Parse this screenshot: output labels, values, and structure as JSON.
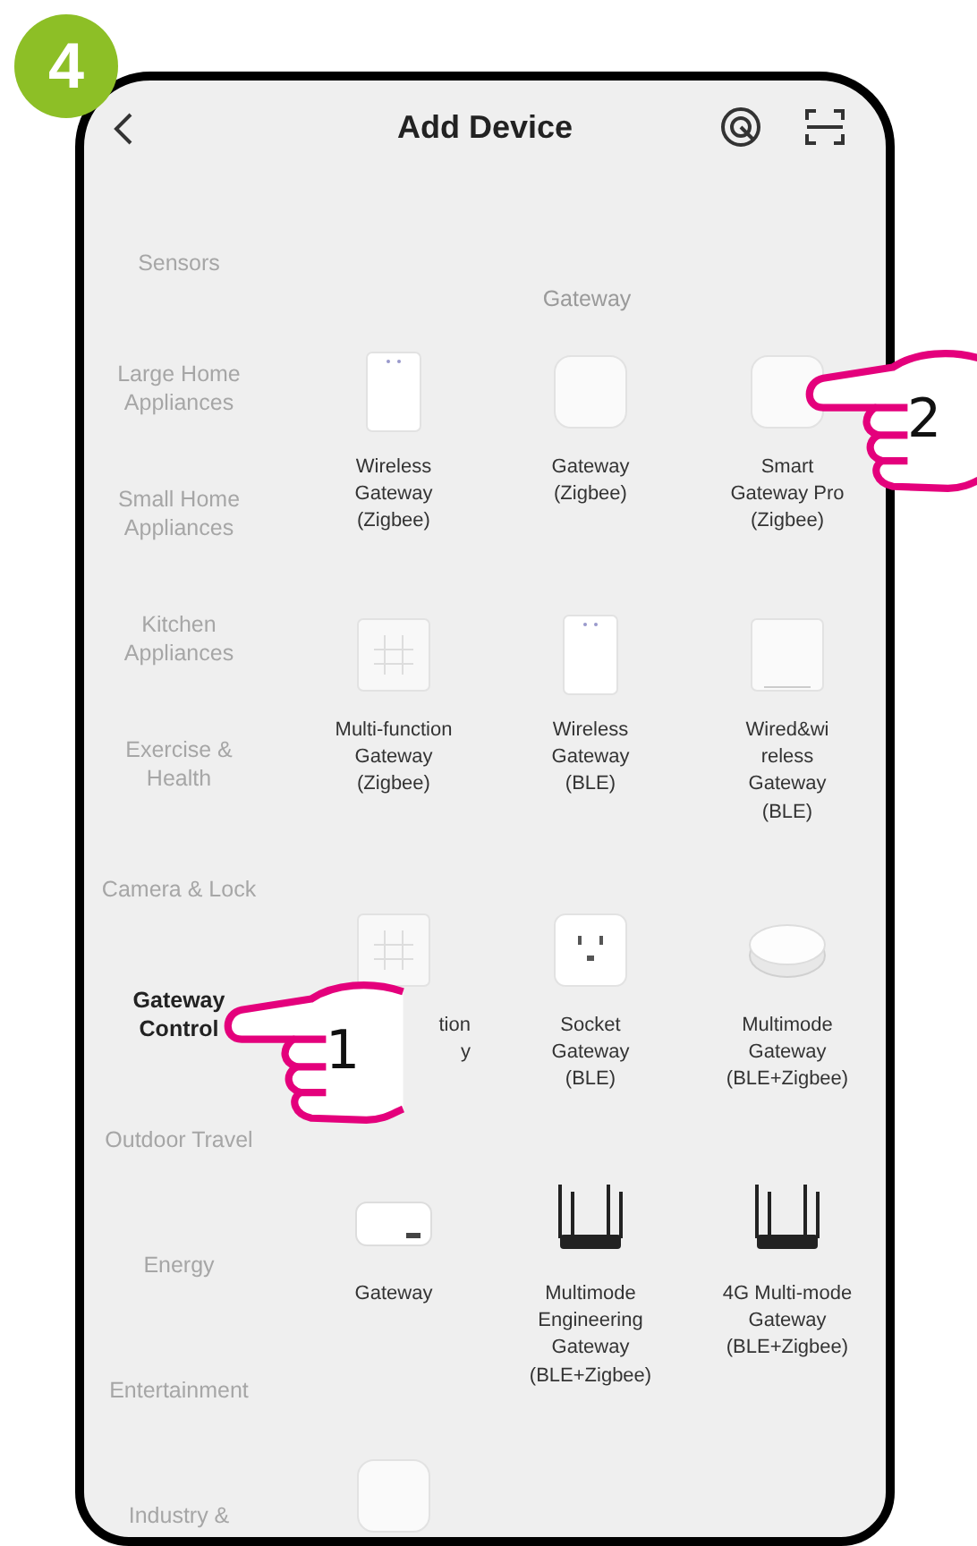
{
  "step_badge": "4",
  "header": {
    "title": "Add Device"
  },
  "sidebar": {
    "items": [
      {
        "label": "Sensors",
        "selected": false
      },
      {
        "label": "Large Home Appliances",
        "selected": false
      },
      {
        "label": "Small Home Appliances",
        "selected": false
      },
      {
        "label": "Kitchen Appliances",
        "selected": false
      },
      {
        "label": "Exercise & Health",
        "selected": false
      },
      {
        "label": "Camera & Lock",
        "selected": false
      },
      {
        "label": "Gateway Control",
        "selected": true
      },
      {
        "label": "Outdoor Travel",
        "selected": false
      },
      {
        "label": "Energy",
        "selected": false
      },
      {
        "label": "Entertainment",
        "selected": false
      },
      {
        "label": "Industry &",
        "selected": false
      }
    ]
  },
  "section": {
    "title": "Gateway",
    "devices": [
      {
        "kind": "tall",
        "label": [
          "Wireless",
          "Gateway",
          "(Zigbee)"
        ]
      },
      {
        "kind": "square",
        "label": [
          "Gateway",
          "(Zigbee)"
        ]
      },
      {
        "kind": "square",
        "label": [
          "Smart",
          "Gateway Pro",
          "(Zigbee)"
        ]
      },
      {
        "kind": "panel",
        "label": [
          "Multi-function",
          "Gateway",
          "(Zigbee)"
        ]
      },
      {
        "kind": "tall",
        "label": [
          "Wireless",
          "Gateway",
          "(BLE)"
        ]
      },
      {
        "kind": "flat",
        "label": [
          "Wired&wi",
          "reless",
          "Gateway",
          "(BLE)"
        ]
      },
      {
        "kind": "panel",
        "label": [
          "tion",
          "y"
        ],
        "covered": true
      },
      {
        "kind": "socket",
        "label": [
          "Socket",
          "Gateway",
          "(BLE)"
        ]
      },
      {
        "kind": "puck",
        "label": [
          "Multimode",
          "Gateway",
          "(BLE+Zigbee)"
        ]
      },
      {
        "kind": "box",
        "label": [
          "Gateway"
        ]
      },
      {
        "kind": "router",
        "label": [
          "Multimode",
          "Engineering",
          "Gateway",
          "(BLE+Zigbee)"
        ]
      },
      {
        "kind": "router",
        "label": [
          "4G Multi-mode",
          "Gateway",
          "(BLE+Zigbee)"
        ]
      },
      {
        "kind": "square"
      }
    ]
  },
  "pointers": [
    {
      "number": "1"
    },
    {
      "number": "2"
    }
  ]
}
